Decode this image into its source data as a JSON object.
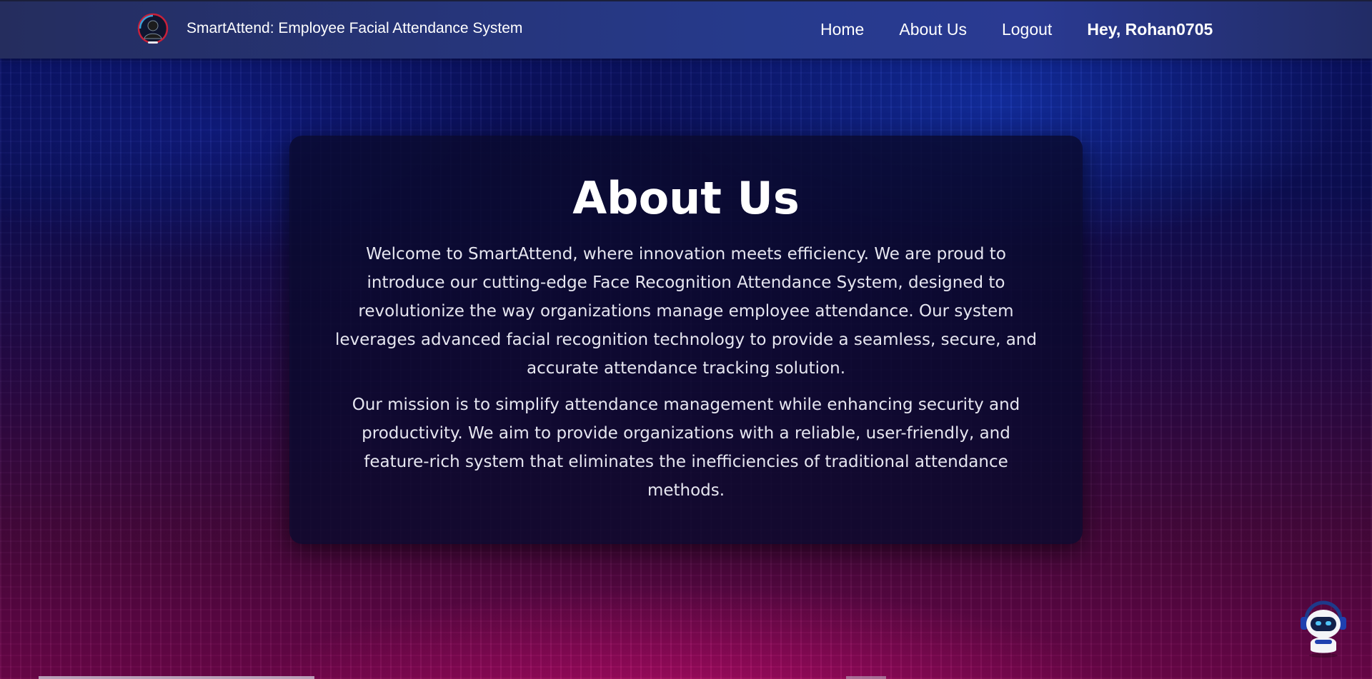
{
  "header": {
    "brand_title": "SmartAttend: Employee Facial Attendance System",
    "nav": [
      {
        "label": "Home"
      },
      {
        "label": "About Us"
      },
      {
        "label": "Logout"
      }
    ],
    "greeting": "Hey, Rohan0705",
    "logo_icon": "face-scan-logo-icon"
  },
  "about": {
    "title": "About Us",
    "paragraphs": [
      "Welcome to SmartAttend, where innovation meets efficiency. We are proud to introduce our cutting-edge Face Recognition Attendance System, designed to revolutionize the way organizations manage employee attendance. Our system leverages advanced facial recognition technology to provide a seamless, secure, and accurate attendance tracking solution.",
      "Our mission is to simplify attendance management while enhancing security and productivity. We aim to provide organizations with a reliable, user-friendly, and feature-rich system that eliminates the inefficiencies of traditional attendance methods."
    ]
  },
  "chatbot": {
    "icon": "robot-chat-icon"
  },
  "colors": {
    "navbar": "#263a8c",
    "card": "#0a0a2d",
    "accent_pink": "#d61078",
    "accent_blue": "#163cc8"
  }
}
